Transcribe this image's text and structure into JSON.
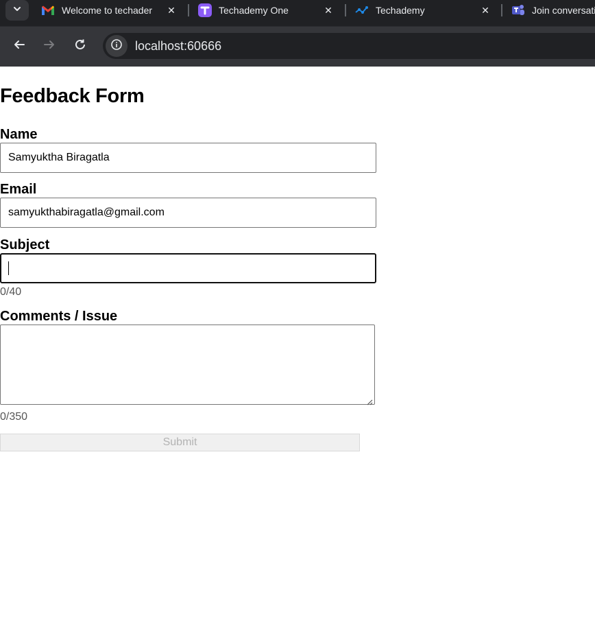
{
  "browser": {
    "tabs": [
      {
        "title": "Welcome to techader",
        "icon": "gmail-icon"
      },
      {
        "title": "Techademy One",
        "icon": "techademy-one-icon"
      },
      {
        "title": "Techademy",
        "icon": "techademy-icon"
      },
      {
        "title": "Join conversati",
        "icon": "teams-icon"
      }
    ],
    "url": "localhost:60666"
  },
  "form": {
    "title": "Feedback Form",
    "name": {
      "label": "Name",
      "value": "Samyuktha Biragatla"
    },
    "email": {
      "label": "Email",
      "value": "samyukthabiragatla@gmail.com"
    },
    "subject": {
      "label": "Subject",
      "value": "",
      "counter": "0/40"
    },
    "comments": {
      "label": "Comments / Issue",
      "value": "",
      "counter": "0/350"
    },
    "submit_label": "Submit"
  },
  "colors": {
    "tabstrip_bg": "#202124",
    "toolbar_bg": "#35363a",
    "disabled_text": "#b3b3b3"
  }
}
